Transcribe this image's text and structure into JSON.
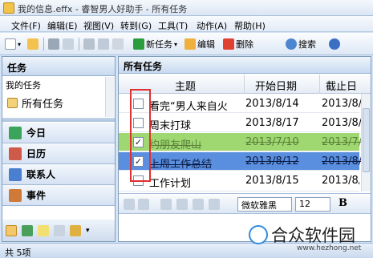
{
  "window": {
    "title": "我的信息.effx - 睿智男人好助手 - 所有任务"
  },
  "menu": [
    "文件(F)",
    "编辑(E)",
    "视图(V)",
    "转到(G)",
    "工具(T)",
    "动作(A)",
    "帮助(H)"
  ],
  "toolbar": {
    "new_task": "新任务",
    "edit": "编辑",
    "delete": "删除",
    "search": "搜索"
  },
  "left": {
    "header": "任务",
    "tree_root": "我的任务",
    "all_tasks": "所有任务",
    "nav": [
      "今日",
      "日历",
      "联系人",
      "事件"
    ]
  },
  "right": {
    "header": "所有任务",
    "columns": {
      "title": "主题",
      "start": "开始日期",
      "end": "截止日"
    },
    "rows": [
      {
        "checked": false,
        "title": "看完“男人来自火",
        "start": "2013/8/14",
        "end": "2013/8/",
        "style": "normal"
      },
      {
        "checked": false,
        "title": "周末打球",
        "start": "2013/8/17",
        "end": "2013/8/",
        "style": "normal"
      },
      {
        "checked": true,
        "title": "约朋友爬山",
        "start": "2013/7/10",
        "end": "2013/7/",
        "style": "green"
      },
      {
        "checked": true,
        "title": "上周工作总结",
        "start": "2013/8/12",
        "end": "2013/8/",
        "style": "blue"
      },
      {
        "checked": false,
        "title": "工作计划",
        "start": "2013/8/15",
        "end": "2013/8/",
        "style": "normal"
      }
    ],
    "editor": {
      "font": "微软雅黑",
      "size": "12",
      "bold": "B"
    }
  },
  "status": {
    "text": "共 5项"
  },
  "watermark": {
    "name": "合众软件园",
    "url": "www.hezhong.net"
  },
  "colors": {
    "accent": "#5a8fe0",
    "done_green": "#9fd870",
    "highlight_box": "#e03030"
  }
}
